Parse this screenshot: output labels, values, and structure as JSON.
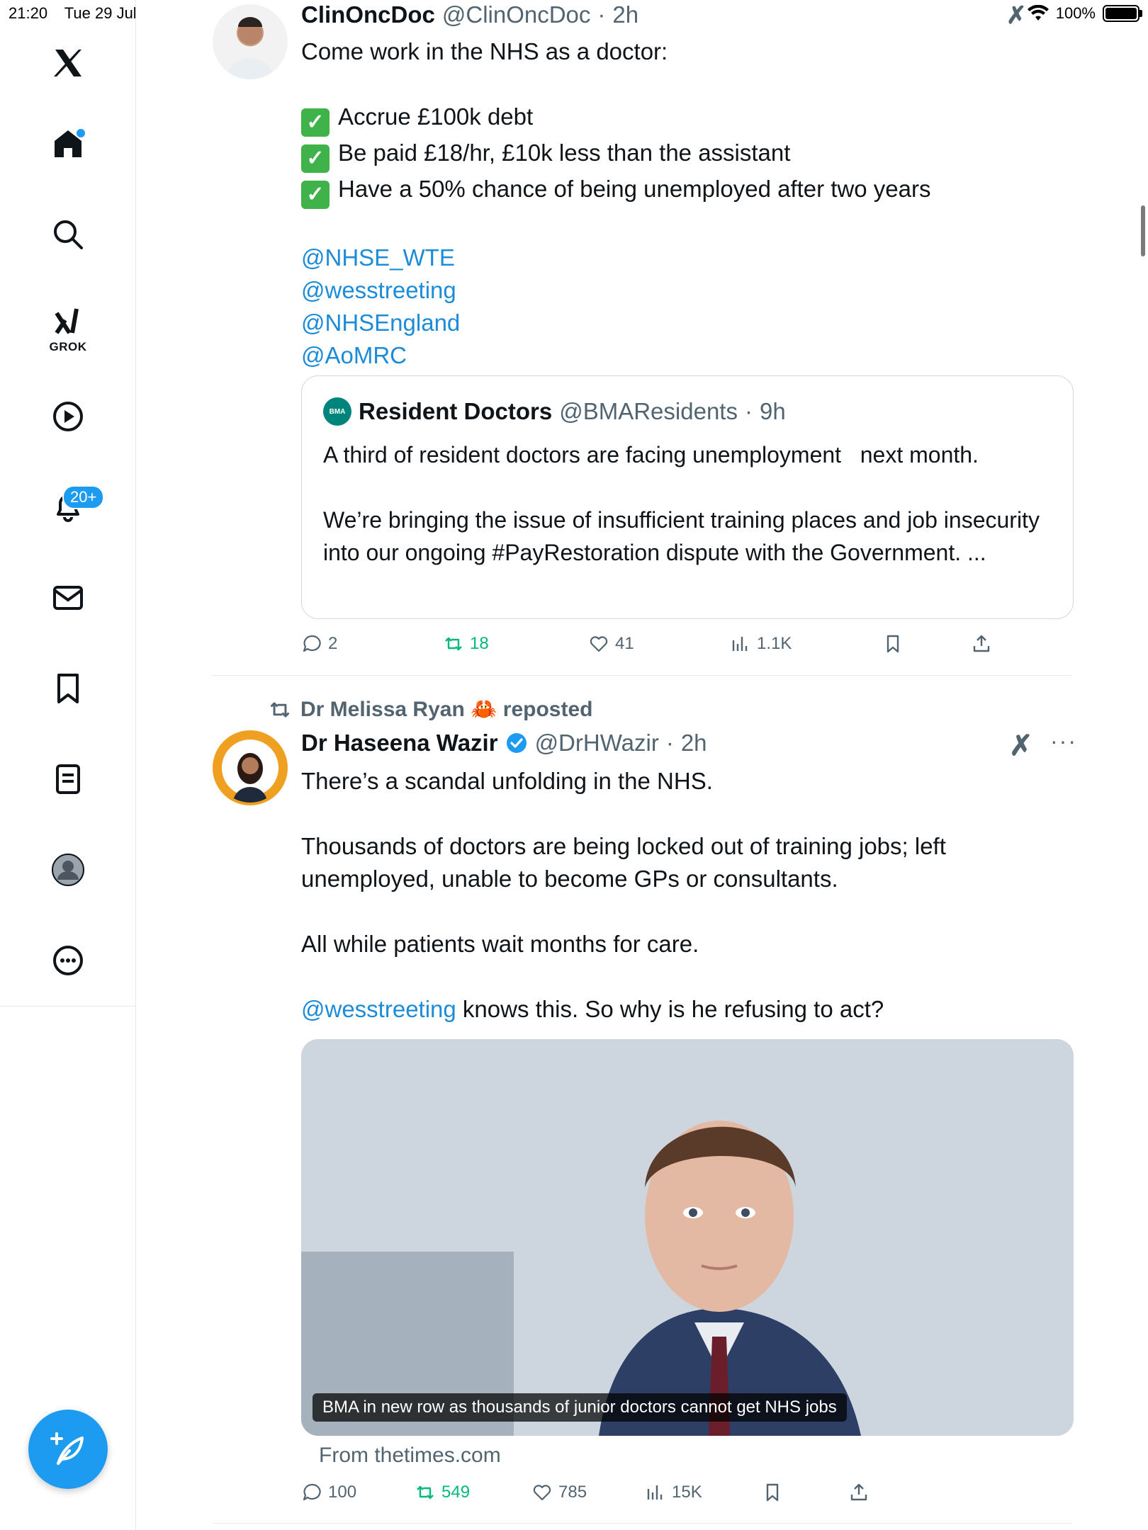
{
  "status_bar": {
    "time": "21:20",
    "date": "Tue 29 Jul",
    "battery": "100%"
  },
  "sidebar": {
    "items": [
      {
        "name": "x-logo-icon"
      },
      {
        "name": "home-icon"
      },
      {
        "name": "search-icon"
      },
      {
        "name": "grok-icon",
        "label": "GROK"
      },
      {
        "name": "video-icon"
      },
      {
        "name": "notifications-icon",
        "badge": "20+"
      },
      {
        "name": "messages-icon"
      },
      {
        "name": "bookmarks-icon"
      },
      {
        "name": "lists-icon"
      },
      {
        "name": "profile-icon"
      },
      {
        "name": "more-icon"
      }
    ],
    "accent": "#1d9bf0"
  },
  "tweets": [
    {
      "name": "ClinOncDoc",
      "handle": "@ClinOncDoc",
      "time": "2h",
      "intro": "Come work in the NHS as a doctor:",
      "bullets": [
        "Accrue £100k debt",
        "Be paid £18/hr, £10k less than the assistant",
        "Have a 50% chance of being unemployed after two years"
      ],
      "mentions": [
        "@NHSE_WTE",
        "@wesstreeting",
        "@NHSEngland",
        "@AoMRC"
      ],
      "quote": {
        "logo": "BMA",
        "name": "Resident Doctors",
        "handle": "@BMAResidents",
        "time": "9h",
        "line1": "A third of resident doctors are facing unemployment   next month.",
        "line2": "We’re bringing the issue of insufficient training places and job insecurity into our ongoing #PayRestoration dispute with the Government. ..."
      },
      "stats": {
        "replies": "2",
        "reposts": "18",
        "likes": "41",
        "views": "1.1K"
      }
    },
    {
      "reposted_by": "Dr Melissa Ryan 🦀 reposted",
      "name": "Dr Haseena Wazir",
      "handle": "@DrHWazir",
      "time": "2h",
      "para1": "There’s a scandal unfolding in the NHS.",
      "para2": "Thousands of doctors are being locked out of training jobs; left unemployed, unable to become GPs or consultants.",
      "para3": "All while patients wait months for care.",
      "para4_mention": "@wesstreeting",
      "para4_rest": " knows this. So why is he refusing to act?",
      "media_caption": "BMA in new row as thousands of junior doctors cannot get NHS jobs",
      "from": "From thetimes.com",
      "stats": {
        "replies": "100",
        "reposts": "549",
        "likes": "785",
        "views": "15K"
      }
    }
  ],
  "dot": "·"
}
